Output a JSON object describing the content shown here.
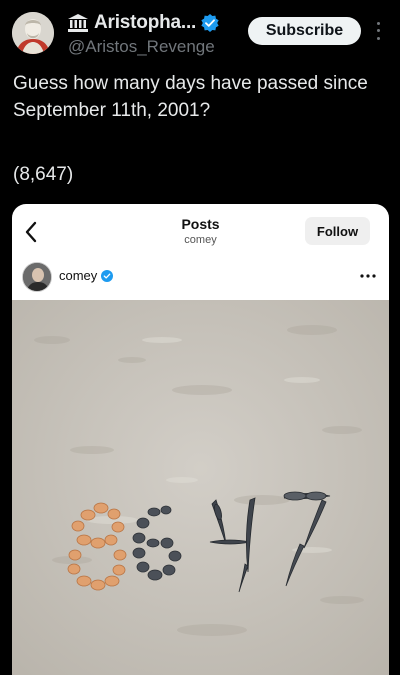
{
  "author": {
    "display_name": "Aristopha...",
    "handle": "@Aristos_Revenge",
    "avatar_icon": "bust-avatar-icon",
    "badge_icon": "temple-icon",
    "verified": true
  },
  "actions": {
    "subscribe_label": "Subscribe"
  },
  "tweet": {
    "text": "Guess how many days have passed since September 11th, 2001?",
    "count_text": "(8,647)"
  },
  "embedded_post": {
    "title": "Posts",
    "subtitle": "comey",
    "follow_label": "Follow",
    "username": "comey",
    "verified": true,
    "sand_message": "8647"
  },
  "colors": {
    "background": "#000000",
    "verified_blue": "#1d9bf0",
    "subscribe_bg": "#eff3f4",
    "sand": "#c9c4bb"
  }
}
